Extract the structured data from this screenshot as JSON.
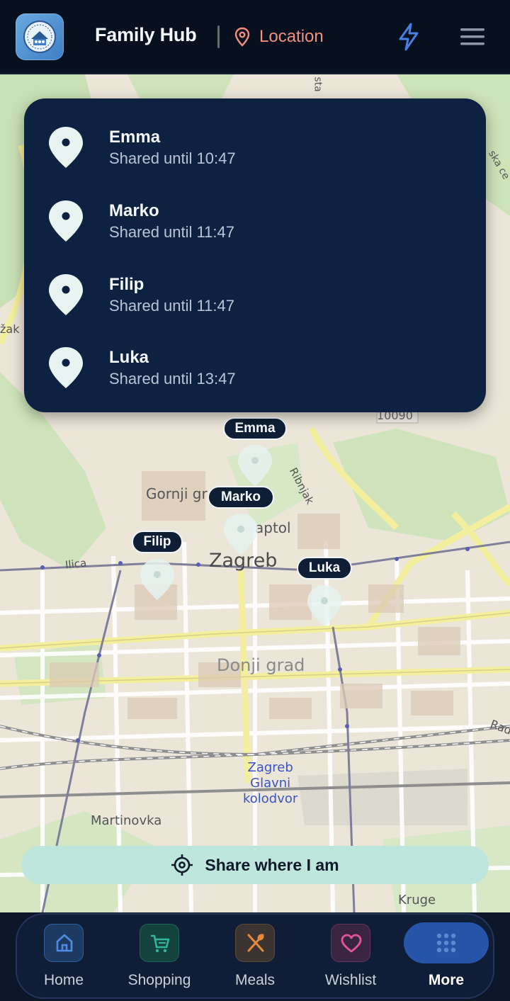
{
  "header": {
    "app_title": "Family Hub",
    "location_label": "Location",
    "accent_color": "#f1907c"
  },
  "share_list": [
    {
      "name": "Emma",
      "until": "Shared until 10:47"
    },
    {
      "name": "Marko",
      "until": "Shared until 11:47"
    },
    {
      "name": "Filip",
      "until": "Shared until 11:47"
    },
    {
      "name": "Luka",
      "until": "Shared until 13:47"
    }
  ],
  "map": {
    "labels": {
      "zagreb": "Zagreb",
      "donji_grad": "Donji grad",
      "gornji_grad": "Gornji gr",
      "kaptol": "aptol",
      "ilica": "Ilica",
      "ribnjak": "Ribnjak",
      "station": "Zagreb Glavni kolodvor",
      "station_l1": "Zagreb",
      "station_l2": "Glavni",
      "station_l3": "kolodvor",
      "martinovka": "Martinovka",
      "kruge": "Kruge",
      "postcode": "10090",
      "edge_zak": "žak",
      "edge_rad": "Rad",
      "edge_ska": "ska ce",
      "edge_sta": "sta"
    },
    "markers": [
      {
        "name": "Emma"
      },
      {
        "name": "Marko"
      },
      {
        "name": "Filip"
      },
      {
        "name": "Luka"
      }
    ]
  },
  "share_button": {
    "label": "Share where I am"
  },
  "nav": {
    "items": [
      {
        "label": "Home",
        "icon": "home-icon"
      },
      {
        "label": "Shopping",
        "icon": "cart-icon"
      },
      {
        "label": "Meals",
        "icon": "utensils-icon"
      },
      {
        "label": "Wishlist",
        "icon": "heart-icon"
      },
      {
        "label": "More",
        "icon": "grid-icon"
      }
    ],
    "active": "More"
  }
}
